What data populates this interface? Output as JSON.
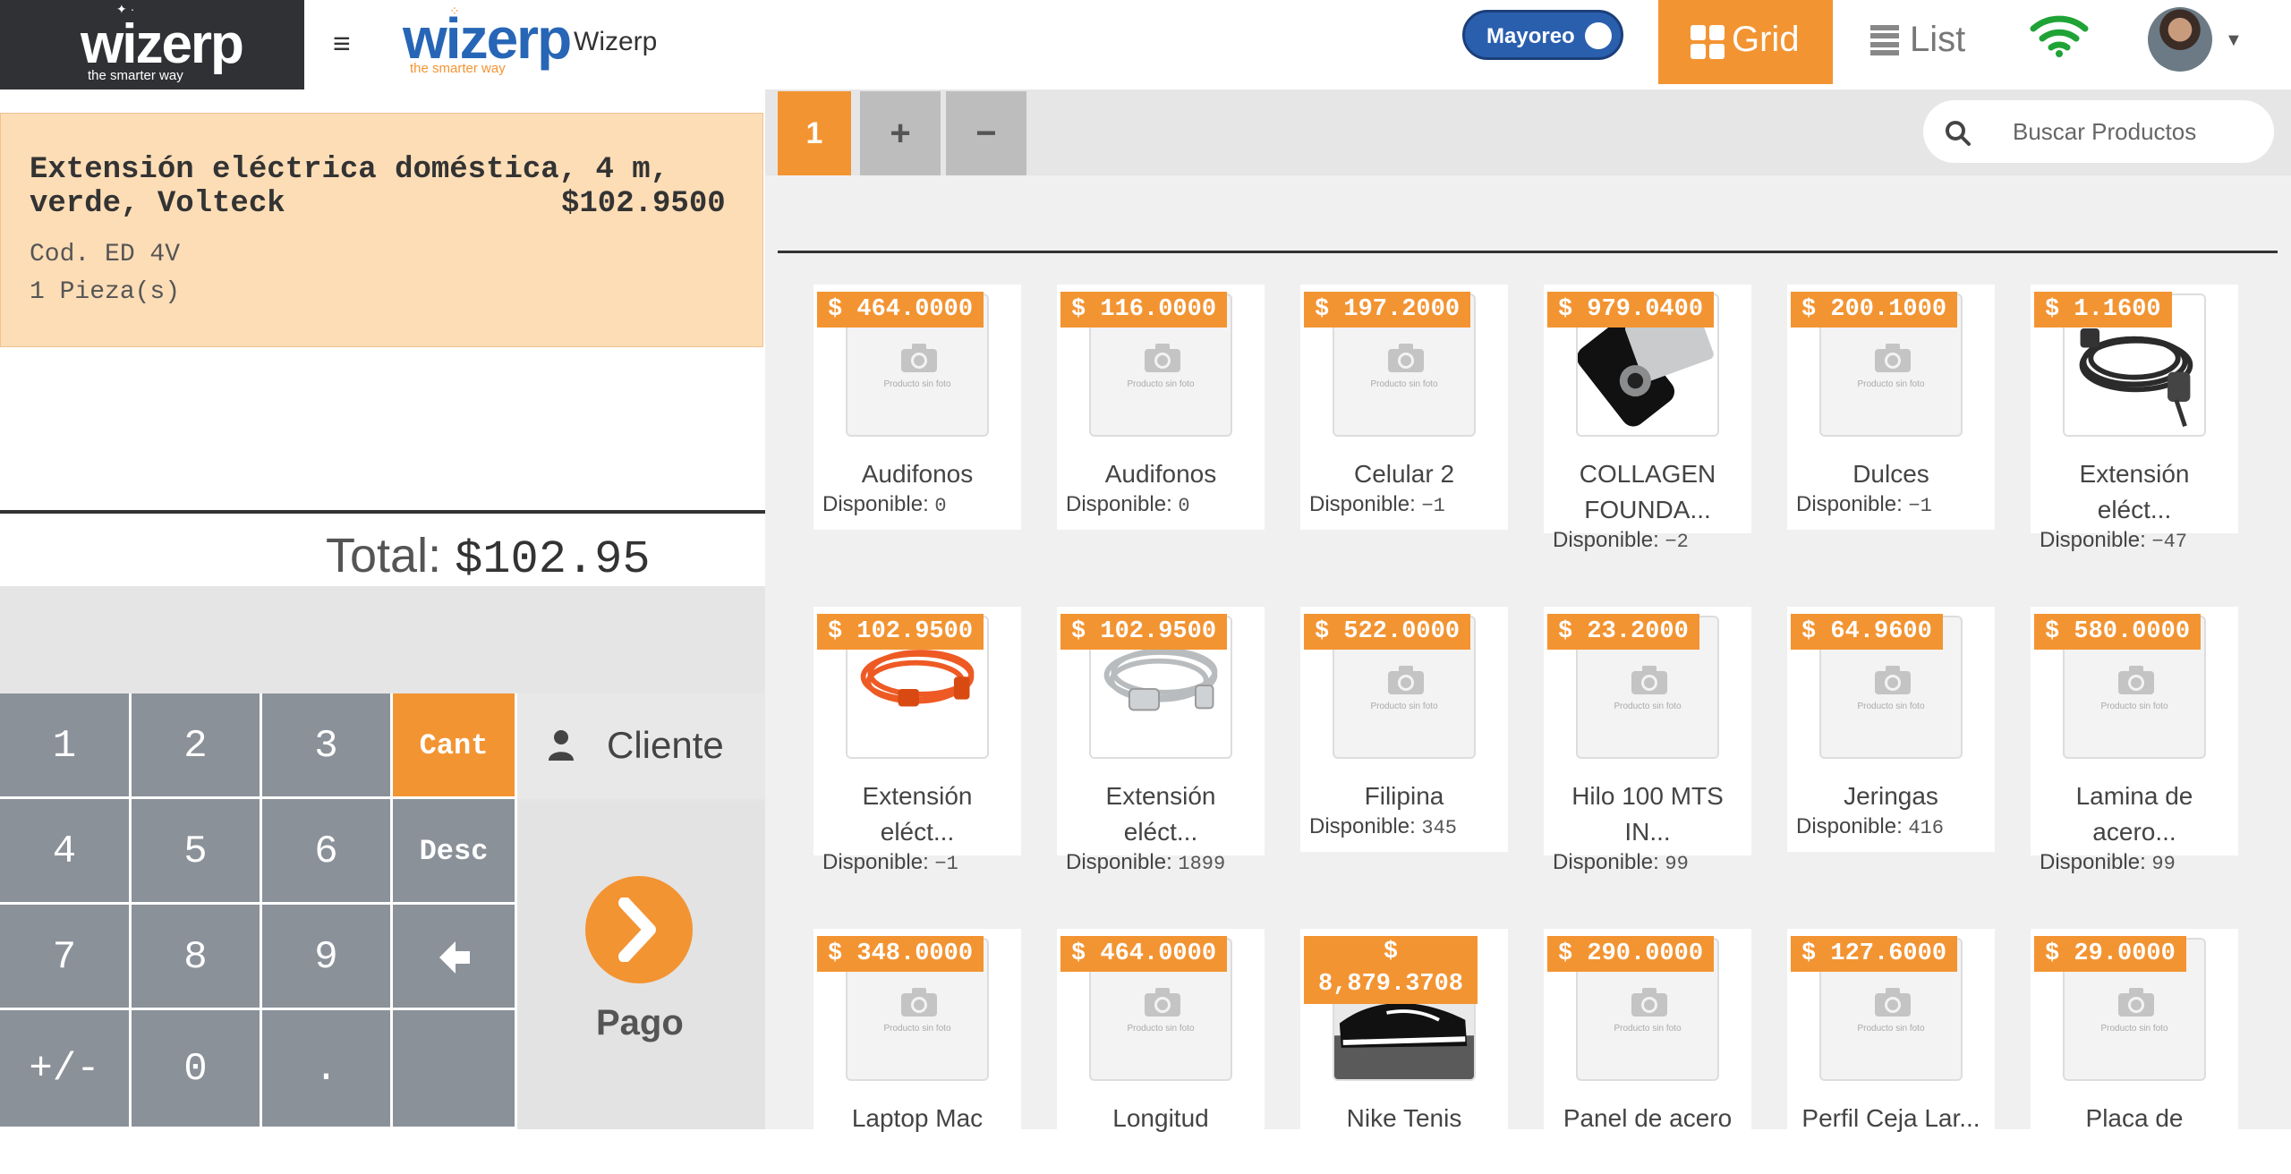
{
  "header": {
    "brand_logo": "wizerp",
    "brand_tagline": "the smarter way",
    "app_logo": "wizerp",
    "app_logo_tagline": "the smarter way",
    "app_title": "Wizerp",
    "mayoreo_label": "Mayoreo",
    "grid_label": "Grid",
    "list_label": "List",
    "icons": [
      "hamburger-icon",
      "wifi-icon",
      "grid-icon",
      "list-icon",
      "caret-down-icon"
    ],
    "accent_color": "#f39432",
    "brand_color": "#2766b6"
  },
  "cart": {
    "item_name": "Extensión eléctrica doméstica, 4 m, verde, Volteck",
    "item_price": "$102.9500",
    "item_code": "Cod. ED 4V",
    "item_qty": "1 Pieza(s)",
    "total_label": "Total:",
    "total_value": "$102.95"
  },
  "keypad": {
    "keys": [
      "1",
      "2",
      "3",
      "4",
      "5",
      "6",
      "7",
      "8",
      "9",
      "+/-",
      "0",
      "."
    ],
    "cant_label": "Cant",
    "desc_label": "Desc",
    "back_icon": "arrow-left-icon",
    "cliente_label": "Cliente",
    "pago_label": "Pago"
  },
  "tabs": {
    "active": "1",
    "add": "+",
    "remove": "−"
  },
  "search": {
    "placeholder": "Buscar Productos"
  },
  "products": [
    {
      "price": "$ 464.0000",
      "name_line1": "Audifonos",
      "name_line2": "",
      "disp_label": "Disponible:",
      "disp": "0",
      "image": "no-photo"
    },
    {
      "price": "$ 116.0000",
      "name_line1": "Audifonos",
      "name_line2": "",
      "disp_label": "Disponible:",
      "disp": "0",
      "image": "no-photo"
    },
    {
      "price": "$ 197.2000",
      "name_line1": "Celular 2",
      "name_line2": "",
      "disp_label": "Disponible:",
      "disp": "−1",
      "image": "no-photo"
    },
    {
      "price": "$ 979.0400",
      "name_line1": "COLLAGEN",
      "name_line2": "FOUNDA...",
      "disp_label": "Disponible:",
      "disp": "−2",
      "image": "usb-drive"
    },
    {
      "price": "$ 200.1000",
      "name_line1": "Dulces",
      "name_line2": "",
      "disp_label": "Disponible:",
      "disp": "−1",
      "image": "no-photo"
    },
    {
      "price": "$ 1.1600",
      "name_line1": "Extensión",
      "name_line2": "eléct...",
      "disp_label": "Disponible:",
      "disp": "−47",
      "image": "black-cable"
    },
    {
      "price": "$ 102.9500",
      "name_line1": "Extensión",
      "name_line2": "eléct...",
      "disp_label": "Disponible:",
      "disp": "−1",
      "image": "orange-cable"
    },
    {
      "price": "$ 102.9500",
      "name_line1": "Extensión",
      "name_line2": "eléct...",
      "disp_label": "Disponible:",
      "disp": "1899",
      "image": "white-cable"
    },
    {
      "price": "$ 522.0000",
      "name_line1": "Filipina",
      "name_line2": "",
      "disp_label": "Disponible:",
      "disp": "345",
      "image": "no-photo"
    },
    {
      "price": "$ 23.2000",
      "name_line1": "Hilo 100 MTS",
      "name_line2": "IN...",
      "disp_label": "Disponible:",
      "disp": "99",
      "image": "no-photo"
    },
    {
      "price": "$ 64.9600",
      "name_line1": "Jeringas",
      "name_line2": "",
      "disp_label": "Disponible:",
      "disp": "416",
      "image": "no-photo"
    },
    {
      "price": "$ 580.0000",
      "name_line1": "Lamina de",
      "name_line2": "acero...",
      "disp_label": "Disponible:",
      "disp": "99",
      "image": "no-photo"
    },
    {
      "price": "$ 348.0000",
      "name_line1": "Laptop Mac",
      "name_line2": "",
      "disp_label": "",
      "disp": "",
      "image": "no-photo"
    },
    {
      "price": "$ 464.0000",
      "name_line1": "Longitud",
      "name_line2": "",
      "disp_label": "",
      "disp": "",
      "image": "no-photo"
    },
    {
      "price_line1": "$",
      "price": "8,879.3708",
      "name_line1": "Nike Tenis",
      "name_line2": "",
      "disp_label": "",
      "disp": "",
      "image": "shoe"
    },
    {
      "price": "$ 290.0000",
      "name_line1": "Panel de acero",
      "name_line2": "",
      "disp_label": "",
      "disp": "",
      "image": "no-photo"
    },
    {
      "price": "$ 127.6000",
      "name_line1": "Perfil Ceja Lar...",
      "name_line2": "",
      "disp_label": "",
      "disp": "",
      "image": "no-photo"
    },
    {
      "price": "$ 29.0000",
      "name_line1": "Placa de",
      "name_line2": "",
      "disp_label": "",
      "disp": "",
      "image": "no-photo"
    }
  ],
  "no_photo_text": "Producto sin foto"
}
